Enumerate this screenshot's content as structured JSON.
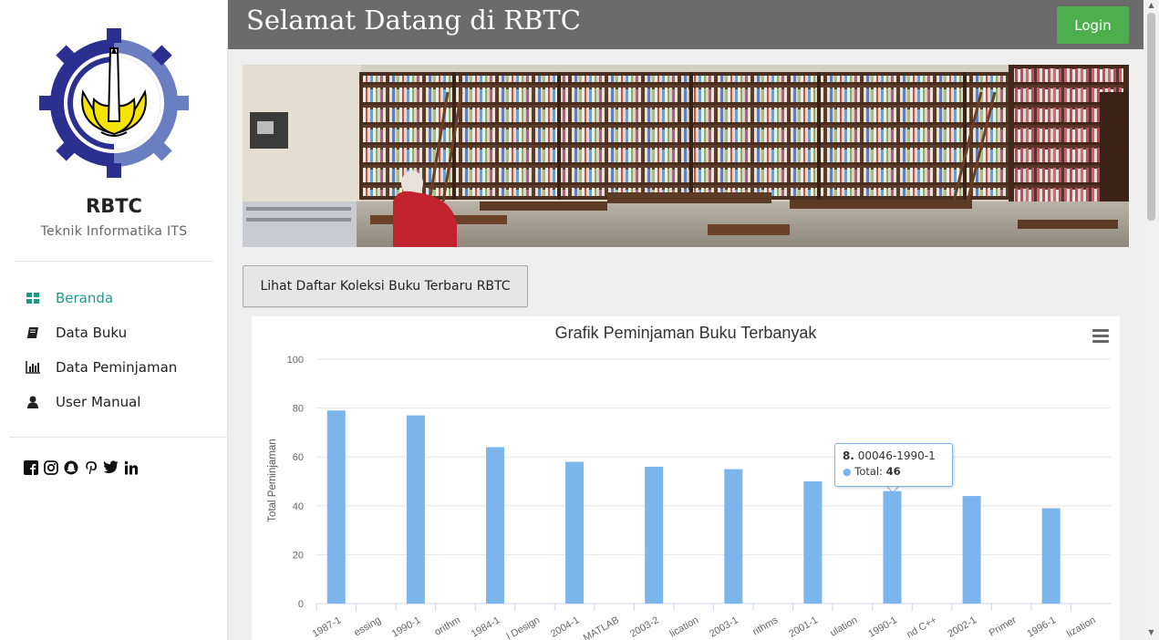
{
  "sidebar": {
    "brand": "RBTC",
    "subtitle": "Teknik Informatika ITS",
    "nav": [
      {
        "label": "Beranda",
        "icon": "dashboard-icon",
        "active": true
      },
      {
        "label": "Data Buku",
        "icon": "book-icon"
      },
      {
        "label": "Data Peminjaman",
        "icon": "bar-chart-icon"
      },
      {
        "label": "User Manual",
        "icon": "user-icon"
      }
    ],
    "social": [
      "facebook-icon",
      "instagram-icon",
      "snapchat-icon",
      "pinterest-icon",
      "twitter-icon",
      "linkedin-icon"
    ]
  },
  "header": {
    "title": "Selamat Datang di RBTC",
    "login_label": "Login"
  },
  "main": {
    "collection_button": "Lihat Daftar Koleksi Buku Terbaru RBTC"
  },
  "colors": {
    "accent": "#1a9b8a",
    "bar": "#7cb5ec",
    "login": "#4cae4c",
    "header": "#6b6b6b"
  },
  "chart_data": {
    "type": "bar",
    "title": "Grafik Peminjaman Buku Terbanyak",
    "ylabel": "Total Peminjaman",
    "xlabel": "",
    "ylim": [
      0,
      100
    ],
    "yticks": [
      0,
      20,
      40,
      60,
      80,
      100
    ],
    "grid": true,
    "categories": [
      "1987-1",
      "essing",
      "1990-1",
      "orithm",
      "1984-1",
      "l Design",
      "2004-1",
      "MATLAB",
      "2003-2",
      "lication",
      "2003-1",
      "rithms",
      "2001-1",
      "ulation",
      "1990-1",
      "nd C++",
      "2002-1",
      "Primer",
      "1996-1",
      "lization"
    ],
    "values": [
      79,
      null,
      77,
      null,
      64,
      null,
      58,
      null,
      56,
      null,
      55,
      null,
      50,
      null,
      46,
      null,
      44,
      null,
      39,
      null
    ],
    "tooltip": {
      "index": "8.",
      "name": "00046-1990-1",
      "series": "Total",
      "value": "46"
    }
  }
}
